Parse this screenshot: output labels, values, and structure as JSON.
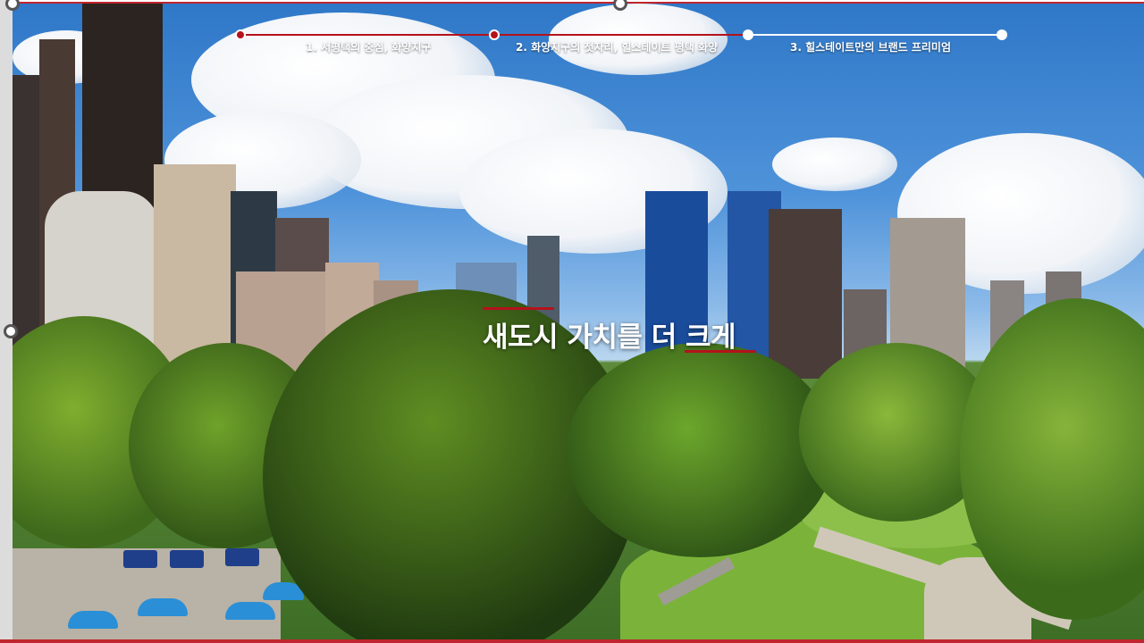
{
  "steps": [
    {
      "label": "1. 서평택의 중심, 화양지구",
      "state": "completed"
    },
    {
      "label": "2. 화양지구의 첫자리, 힐스테이트 평택 화양",
      "state": "completed"
    },
    {
      "label": "3. 힐스테이트만의 브랜드 프리미엄",
      "state": "upcoming"
    }
  ],
  "headline": "새도시 가치를 더 크게",
  "colors": {
    "accent": "#b5121b",
    "track": "#ffffff",
    "text": "#ffffff"
  }
}
